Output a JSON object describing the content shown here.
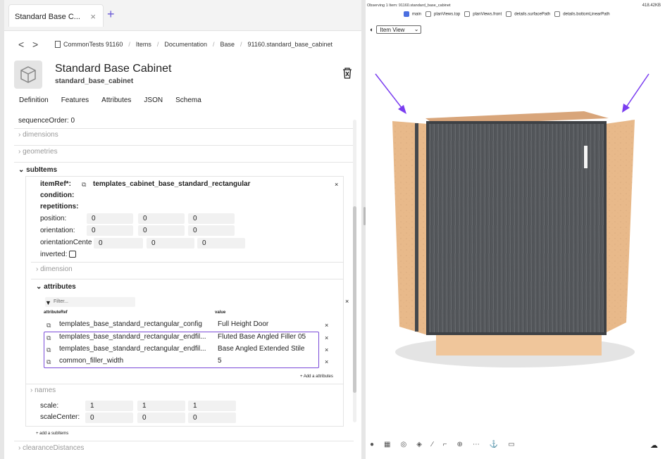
{
  "tab": {
    "title": "Standard Base C...",
    "close": "×",
    "add": "+"
  },
  "breadcrumb": {
    "back": "<",
    "forward": ">",
    "items": [
      "CommonTests 91160",
      "Items",
      "Documentation",
      "Base",
      "91160.standard_base_cabinet"
    ],
    "separator": "/"
  },
  "header": {
    "title": "Standard Base Cabinet",
    "subtitle": "standard_base_cabinet"
  },
  "subtabs": [
    "Definition",
    "Features",
    "Attributes",
    "JSON",
    "Schema"
  ],
  "tree": {
    "sequence_order": "sequenceOrder: 0",
    "dimensions": "dimensions",
    "geometries": "geometries",
    "subitems": "subItems",
    "item_ref_label": "itemRef*:",
    "item_ref_value": "templates_cabinet_base_standard_rectangular",
    "condition": "condition:",
    "repetitions": "repetitions:",
    "position_label": "position:",
    "position": [
      "0",
      "0",
      "0"
    ],
    "orientation_label": "orientation:",
    "orientation": [
      "0",
      "0",
      "0"
    ],
    "orientation_center_label": "orientationCente",
    "orientation_center": [
      "0",
      "0",
      "0"
    ],
    "inverted_label": "inverted:",
    "dimension": "dimension",
    "attributes": "attributes",
    "filter_placeholder": "Filter...",
    "col_ref": "attributeRef",
    "col_value": "value",
    "attribute_rows": [
      {
        "ref": "templates_base_standard_rectangular_config",
        "value": "Full Height Door"
      },
      {
        "ref": "templates_base_standard_rectangular_endfil...",
        "value": "Fluted Base Angled Filler 05"
      },
      {
        "ref": "templates_base_standard_rectangular_endfil...",
        "value": "Base Angled Extended Stile"
      },
      {
        "ref": "common_filler_width",
        "value": "5"
      }
    ],
    "add_attribute": "+ Add a attributes",
    "names": "names",
    "scale_label": "scale:",
    "scale": [
      "1",
      "1",
      "1"
    ],
    "scale_center_label": "scaleCenter:",
    "scale_center": [
      "0",
      "0",
      "0"
    ],
    "add_subitem": "+ add a subItems",
    "clearance": "clearanceDistances",
    "remove": "×"
  },
  "viewer": {
    "status": "Observing 1 Item: 91160.standard_base_cabinet",
    "size": "418.42KB",
    "views": [
      {
        "label": "main",
        "checked": true
      },
      {
        "label": "planViews.top",
        "checked": false
      },
      {
        "label": "planViews.front",
        "checked": false
      },
      {
        "label": "details.surfacePath",
        "checked": false
      },
      {
        "label": "details.bottomLinearPath",
        "checked": false
      }
    ],
    "view_select": "Item View",
    "arrow_color": "#7a3df0",
    "door_color": "#55585c",
    "panel_color": "#e8b98a"
  },
  "toolbar_icons": [
    "palette-icon",
    "grid-icon",
    "compass-icon",
    "cube-icon",
    "pen-icon",
    "crop-icon",
    "target-icon",
    "dots-icon",
    "anchor-icon",
    "layers-icon"
  ]
}
